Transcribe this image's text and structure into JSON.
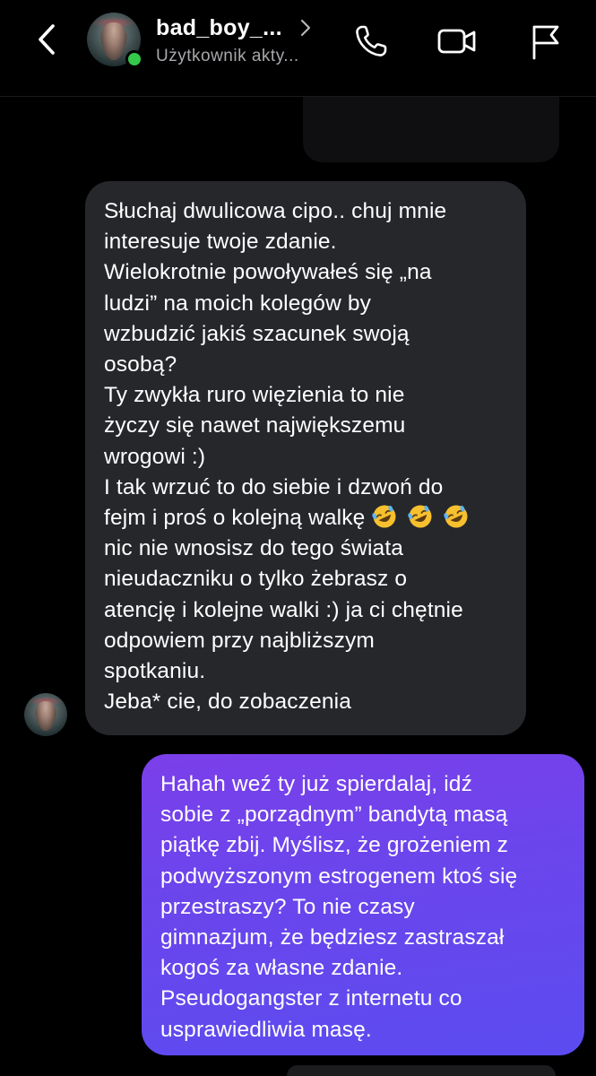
{
  "header": {
    "contact_name": "bad_boy_...",
    "status": "Użytkownik akty...",
    "icons": {
      "back": "chevron-left-icon",
      "name_chevron": "chevron-right-icon",
      "call": "phone-icon",
      "video": "video-camera-icon",
      "report": "flag-icon"
    },
    "online": true
  },
  "messages": {
    "incoming": {
      "lines": [
        "Słuchaj dwulicowa cipo.. chuj mnie",
        "interesuje twoje zdanie.",
        "Wielokrotnie powoływałeś się „na",
        "ludzi” na moich kolegów by",
        "wzbudzić jakiś szacunek swoją",
        "osobą?",
        "Ty zwykła ruro więzienia to nie",
        "życzy się nawet największemu",
        "wrogowi :)",
        "I tak wrzuć to do siebie i dzwoń do",
        "fejm i proś o kolejną walkę",
        "nic nie wnosisz do tego świata",
        "nieudaczniku o tylko żebrasz o",
        "atencję i kolejne walki :) ja ci chętnie",
        "odpowiem przy najbliższym",
        "spotkaniu.",
        "Jeba* cie, do zobaczenia"
      ],
      "emoji": [
        "rolling-on-floor-laughing-emoji",
        "rolling-on-floor-laughing-emoji",
        "rolling-on-floor-laughing-emoji"
      ]
    },
    "outgoing": {
      "lines": [
        "Hahah weź ty już spierdalaj, idź",
        "sobie z „porządnym” bandytą masą",
        "piątkę zbij. Myślisz, że grożeniem z",
        "podwyższonym estrogenem ktoś się",
        "przestraszy? To nie czasy",
        "gimnazjum, że będziesz zastraszał",
        "kogoś za własne zdanie.",
        "Pseudogangster z internetu co",
        "usprawiedliwia masę."
      ]
    }
  },
  "colors": {
    "background": "#000000",
    "incoming_bubble": "#25272b",
    "outgoing_gradient_start": "#7b3fea",
    "outgoing_gradient_end": "#5b4cf0",
    "online": "#35c84b",
    "status_text": "#a8a8ad"
  }
}
